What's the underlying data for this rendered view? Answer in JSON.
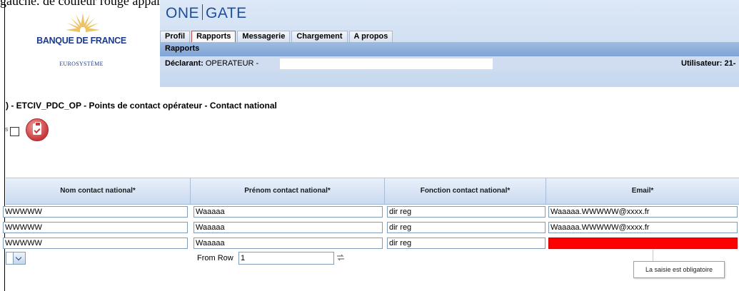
{
  "caption_fragment": "gauche.  de couleur rouge apparait.",
  "logo": {
    "org": "BANQUE DE FRANCE",
    "sub": "EUROSYSTÈME"
  },
  "app": {
    "name_left": "ONE",
    "name_right": "GATE",
    "color": "#1c4f9c"
  },
  "tabs": [
    {
      "label": "Profil"
    },
    {
      "label": "Rapports",
      "active": true
    },
    {
      "label": "Messagerie"
    },
    {
      "label": "Chargement"
    },
    {
      "label": "A propos"
    }
  ],
  "subnav": {
    "label": "Rapports"
  },
  "declarant": {
    "label": "Déclarant:",
    "value": "OPERATEUR -",
    "user": "Utilisateur: 21-"
  },
  "page_title": ") - ETCIV_PDC_OP - Points de contact opérateur - Contact national",
  "checkbox_fragment": "s",
  "grid": {
    "columns": [
      "Nom contact national*",
      "Prénom contact national*",
      "Fonction contact national*",
      "Email*"
    ],
    "rows": [
      [
        "WWWWW",
        "Waaaaa",
        "dir reg",
        "Waaaaa.WWWWW@xxxx.fr"
      ],
      [
        "WWWWW",
        "Waaaaa",
        "dir reg",
        "Waaaaa.WWWWW@xxxx.fr"
      ],
      [
        "WWWWW",
        "Waaaaa",
        "dir reg",
        ""
      ]
    ],
    "error_color": "#ff0000"
  },
  "pager": {
    "from_label": "From Row",
    "from_value": "1"
  },
  "tooltip": "La saisie est obligatoire"
}
